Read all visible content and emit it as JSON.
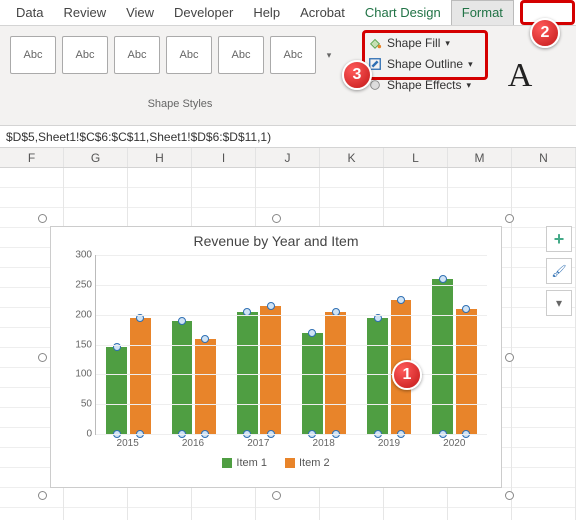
{
  "ribbon": {
    "tabs": [
      "Data",
      "Review",
      "View",
      "Developer",
      "Help",
      "Acrobat",
      "Chart Design",
      "Format"
    ],
    "swatch_label": "Abc",
    "shape_fill": "Shape Fill",
    "shape_outline": "Shape Outline",
    "shape_effects": "Shape Effects",
    "group_label": "Shape Styles",
    "wordart_glyph": "A"
  },
  "formula": "$D$5,Sheet1!$C$6:$C$11,Sheet1!$D$6:$D$11,1)",
  "columns": [
    "F",
    "G",
    "H",
    "I",
    "J",
    "K",
    "L",
    "M",
    "N"
  ],
  "callouts": {
    "b1": "1",
    "b2": "2",
    "b3": "3"
  },
  "side_buttons": {
    "plus": "+",
    "brush": "✎",
    "filter": "⧩"
  },
  "chart_data": {
    "type": "bar",
    "title": "Revenue by Year and Item",
    "categories": [
      "2015",
      "2016",
      "2017",
      "2018",
      "2019",
      "2020"
    ],
    "series": [
      {
        "name": "Item 1",
        "values": [
          145,
          190,
          205,
          170,
          195,
          260
        ],
        "color": "#4f9e42"
      },
      {
        "name": "Item 2",
        "values": [
          195,
          160,
          215,
          205,
          225,
          210
        ],
        "color": "#e8842a"
      }
    ],
    "ylim": [
      0,
      300
    ],
    "ystep": 50,
    "xlabel": "",
    "ylabel": ""
  }
}
